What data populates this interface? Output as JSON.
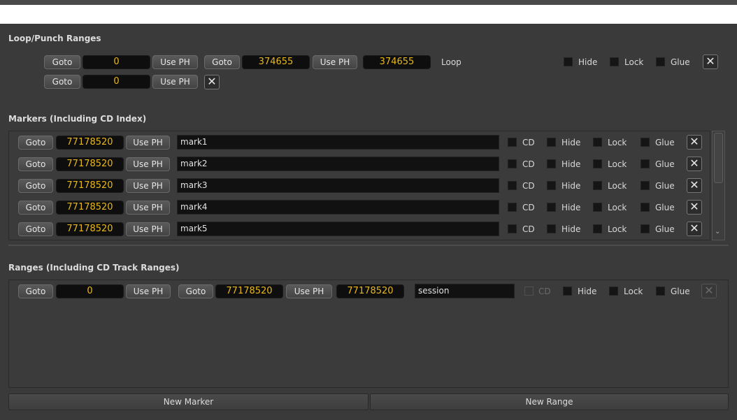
{
  "loop_punch": {
    "title": "Loop/Punch Ranges",
    "loop": {
      "goto1": "Goto",
      "start": "0",
      "useph1": "Use PH",
      "goto2": "Goto",
      "end": "374655",
      "useph2": "Use PH",
      "length": "374655",
      "name": "Loop",
      "hide": "Hide",
      "lock": "Lock",
      "glue": "Glue"
    },
    "punch": {
      "goto": "Goto",
      "start": "0",
      "useph": "Use PH"
    }
  },
  "markers": {
    "title": "Markers (Including CD Index)",
    "items": [
      {
        "goto": "Goto",
        "position": "77178520",
        "useph": "Use PH",
        "name": "mark1",
        "cd": "CD",
        "hide": "Hide",
        "lock": "Lock",
        "glue": "Glue"
      },
      {
        "goto": "Goto",
        "position": "77178520",
        "useph": "Use PH",
        "name": "mark2",
        "cd": "CD",
        "hide": "Hide",
        "lock": "Lock",
        "glue": "Glue"
      },
      {
        "goto": "Goto",
        "position": "77178520",
        "useph": "Use PH",
        "name": "mark3",
        "cd": "CD",
        "hide": "Hide",
        "lock": "Lock",
        "glue": "Glue"
      },
      {
        "goto": "Goto",
        "position": "77178520",
        "useph": "Use PH",
        "name": "mark4",
        "cd": "CD",
        "hide": "Hide",
        "lock": "Lock",
        "glue": "Glue"
      },
      {
        "goto": "Goto",
        "position": "77178520",
        "useph": "Use PH",
        "name": "mark5",
        "cd": "CD",
        "hide": "Hide",
        "lock": "Lock",
        "glue": "Glue"
      }
    ]
  },
  "ranges": {
    "title": "Ranges (Including CD Track Ranges)",
    "session": {
      "goto1": "Goto",
      "start": "0",
      "useph1": "Use PH",
      "goto2": "Goto",
      "end": "77178520",
      "useph2": "Use PH",
      "length": "77178520",
      "name": "session",
      "cd": "CD",
      "hide": "Hide",
      "lock": "Lock",
      "glue": "Glue"
    }
  },
  "footer": {
    "new_marker": "New Marker",
    "new_range": "New Range"
  },
  "icons": {
    "remove": "close-icon",
    "scroll_up": "chevron-up-icon",
    "scroll_down": "chevron-down-icon"
  },
  "colors": {
    "clock_text": "#e8b81a",
    "background": "#3a3a3a"
  }
}
